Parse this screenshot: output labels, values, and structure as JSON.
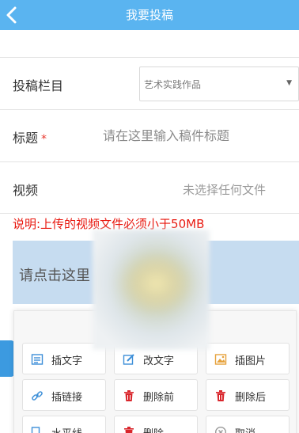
{
  "header": {
    "title": "我要投稿",
    "back_icon": "chevron-left-icon",
    "background": "#5ab4f0"
  },
  "form": {
    "column": {
      "label": "投稿栏目",
      "selected_value": "艺术实践作品"
    },
    "title": {
      "label": "标题",
      "required_mark": "*",
      "placeholder": "请在这里输入稿件标题",
      "value": ""
    },
    "video": {
      "label": "视频",
      "file_status": "未选择任何文件"
    }
  },
  "notice": {
    "text": "说明:上传的视频文件必须小于50MB",
    "color": "#e8170e"
  },
  "upload": {
    "prompt": "请点击这里"
  },
  "actions": [
    {
      "label": "插文字",
      "icon": "insert-text-icon"
    },
    {
      "label": "改文字",
      "icon": "edit-text-icon"
    },
    {
      "label": "插图片",
      "icon": "insert-image-icon"
    },
    {
      "label": "插链接",
      "icon": "link-icon"
    },
    {
      "label": "删除前",
      "icon": "trash-icon"
    },
    {
      "label": "删除后",
      "icon": "trash-icon"
    },
    {
      "label": "水平线",
      "icon": "horizontal-line-icon"
    },
    {
      "label": "删除",
      "icon": "trash-icon"
    },
    {
      "label": "取消",
      "icon": "cancel-icon"
    }
  ],
  "colors": {
    "accent": "#5ab4f0",
    "danger": "#e8382f",
    "upload_bg": "#c6dcf0"
  }
}
